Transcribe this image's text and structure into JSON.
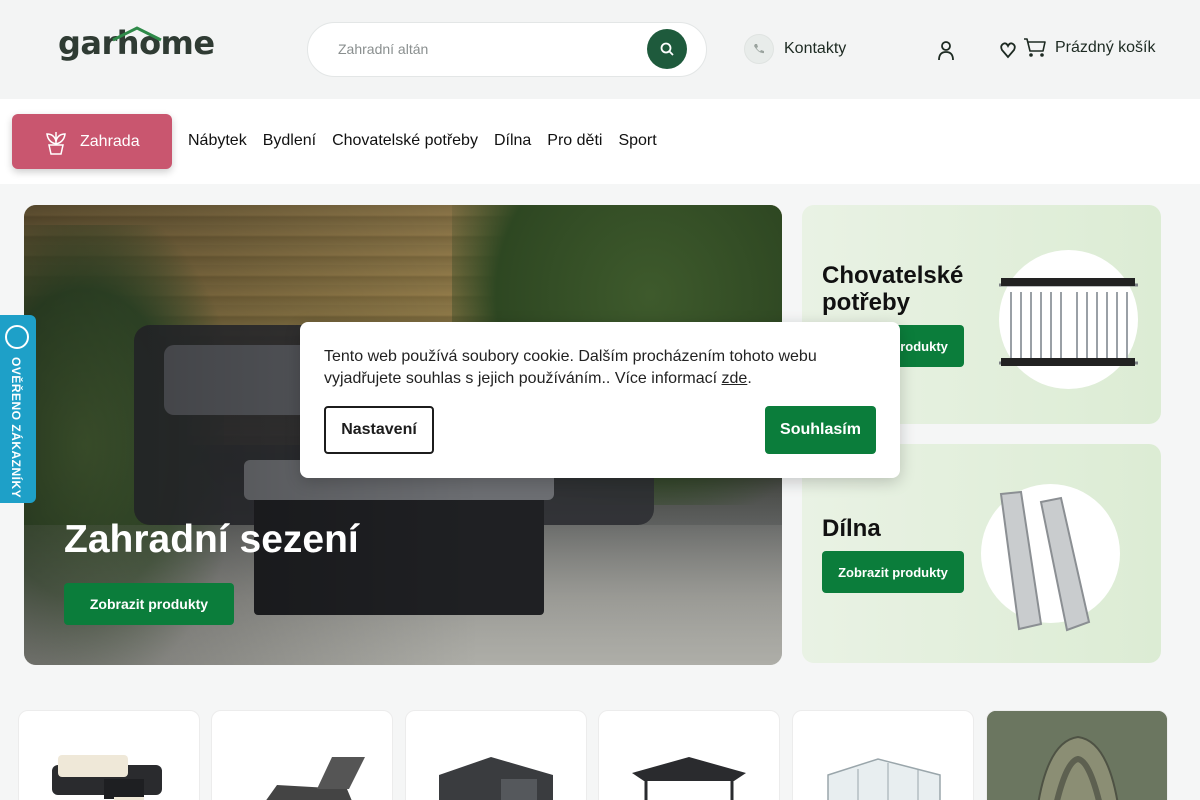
{
  "header": {
    "logo_text": "garhome",
    "search": {
      "placeholder": "Zahradní altán"
    },
    "contacts_label": "Kontakty",
    "cart_label": "Prázdný košík"
  },
  "nav": {
    "active_label": "Zahrada",
    "items": [
      "Nábytek",
      "Bydlení",
      "Chovatelské potřeby",
      "Dílna",
      "Pro děti",
      "Sport"
    ]
  },
  "hero": {
    "title": "Zahradní sezení",
    "button_label": "Zobrazit produkty"
  },
  "side_cards": [
    {
      "title": "Chovatelské potřeby",
      "button_label": "Zobrazit produkty"
    },
    {
      "title": "Dílna",
      "button_label": "Zobrazit produkty"
    }
  ],
  "badge": {
    "text": "OVĚŘENO ZÁKAZNÍKY"
  },
  "cookie": {
    "text": "Tento web používá soubory cookie. Dalším procházením tohoto webu vyjadřujete souhlas s jejich používáním.. Více informací",
    "link_text": "zde",
    "settings_label": "Nastavení",
    "agree_label": "Souhlasím"
  },
  "colors": {
    "brand_green": "#0b7d3b",
    "search_button": "#1e5a3c",
    "nav_active": "#c9566f",
    "badge": "#1ea0c8"
  },
  "icons": [
    "search-icon",
    "phone-icon",
    "user-icon",
    "heart-icon",
    "cart-icon",
    "plant-icon"
  ]
}
